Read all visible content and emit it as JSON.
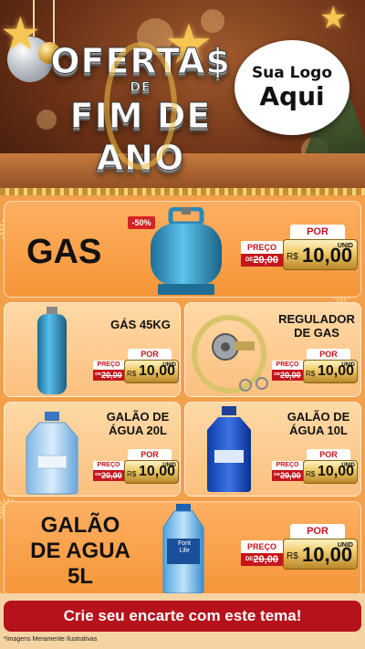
{
  "header": {
    "title_line1": "OFERTA$",
    "title_line2": "DE",
    "title_line3": "FIM DE ANO",
    "logo_line1": "Sua Logo",
    "logo_line2": "Aqui"
  },
  "products": [
    {
      "name": "GAS",
      "discount": "-50%",
      "por": "POR",
      "preco": "PREÇO",
      "de": "DE",
      "old": "20,00",
      "currency": "R$",
      "price": "10,00",
      "unit": "UNID"
    },
    {
      "name": "GÁS 45KG",
      "por": "POR",
      "preco": "PREÇO",
      "de": "DE",
      "old": "20,00",
      "currency": "R$",
      "price": "10,00",
      "unit": "UNID"
    },
    {
      "name_l1": "REGULADOR",
      "name_l2": "DE GAS",
      "por": "POR",
      "preco": "PREÇO",
      "de": "DE",
      "old": "20,00",
      "currency": "R$",
      "price": "10,00",
      "unit": "UNID"
    },
    {
      "name_l1": "GALÃO DE",
      "name_l2": "ÁGUA 20L",
      "por": "POR",
      "preco": "PREÇO",
      "de": "DE",
      "old": "20,00",
      "currency": "R$",
      "price": "10,00",
      "unit": "UNID"
    },
    {
      "name_l1": "GALÃO DE",
      "name_l2": "ÁGUA 10L",
      "por": "POR",
      "preco": "PREÇO",
      "de": "DE",
      "old": "20,00",
      "currency": "R$",
      "price": "10,00",
      "unit": "UNID"
    },
    {
      "name_l1": "GALÃO",
      "name_l2": "DE AGUA",
      "name_l3": "5L",
      "por": "POR",
      "preco": "PREÇO",
      "de": "DE",
      "old": "20,00",
      "currency": "R$",
      "price": "10,00",
      "unit": "UNID",
      "bottle_brand_l1": "Font",
      "bottle_brand_l2": "Life"
    }
  ],
  "footer": {
    "cta": "Crie seu encarte com este tema!",
    "disclaimer": "*Imagens Meramente Ilustrativas"
  },
  "colors": {
    "accent_red": "#c4161c",
    "card_orange": "#f69538",
    "card_light": "#fbc07f",
    "header_brown": "#6a3116"
  }
}
